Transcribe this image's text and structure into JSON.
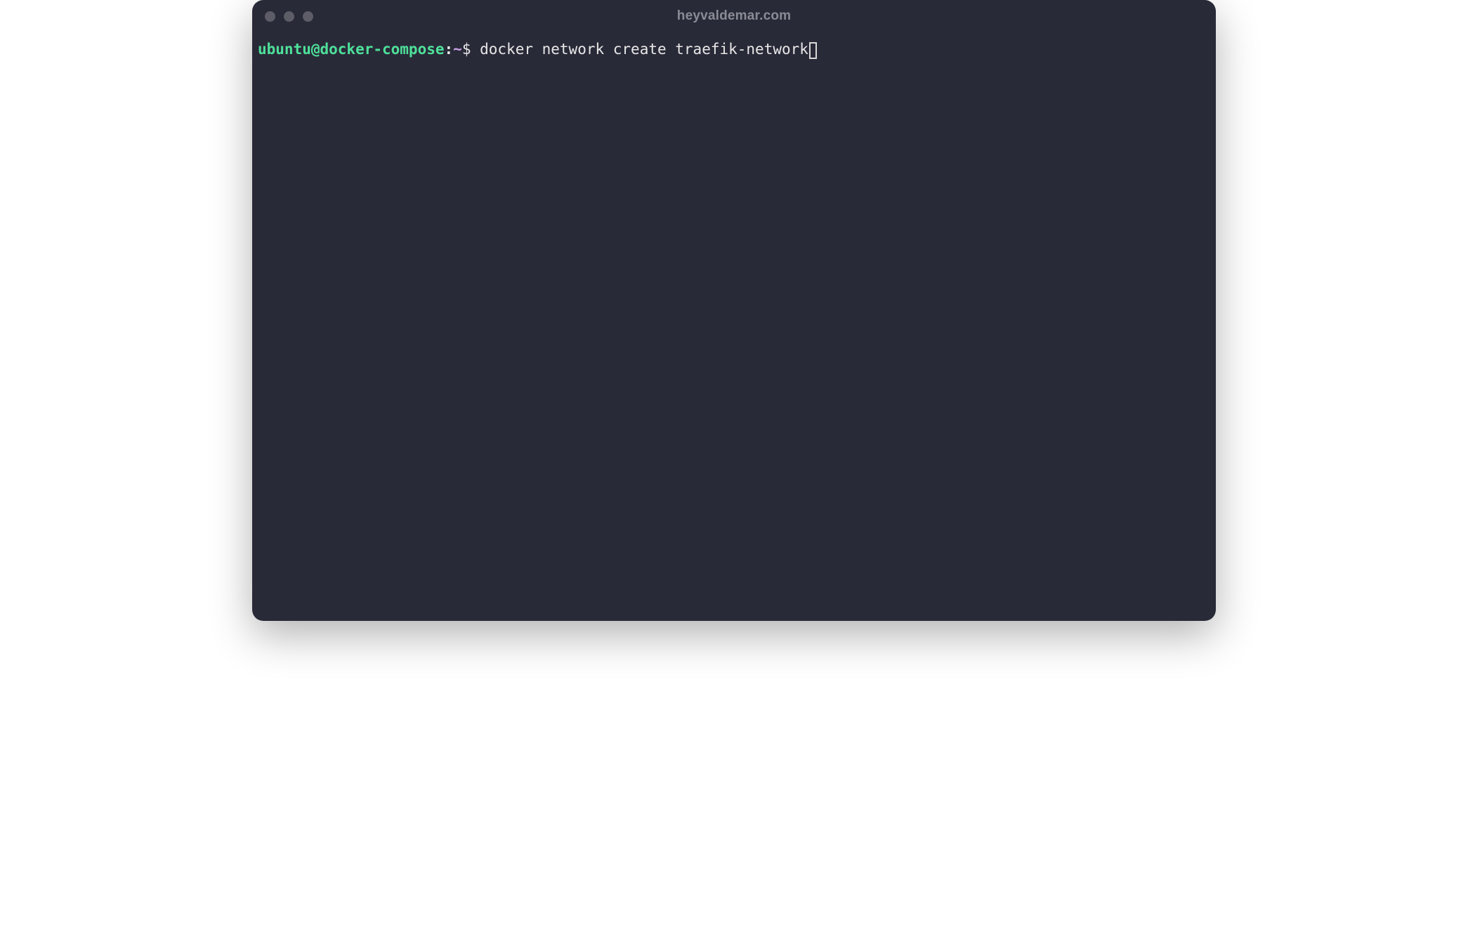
{
  "window": {
    "title": "heyvaldemar.com"
  },
  "terminal": {
    "prompt": {
      "user_host": "ubuntu@docker-compose",
      "colon": ":",
      "path": "~",
      "symbol": "$ "
    },
    "command": "docker network create traefik-network"
  },
  "colors": {
    "background": "#292a38",
    "prompt_user_host": "#4ee09a",
    "prompt_path": "#c9a0e8",
    "text": "#e8e8e8",
    "title": "#8a8b95",
    "traffic_light": "#5c5d67"
  }
}
